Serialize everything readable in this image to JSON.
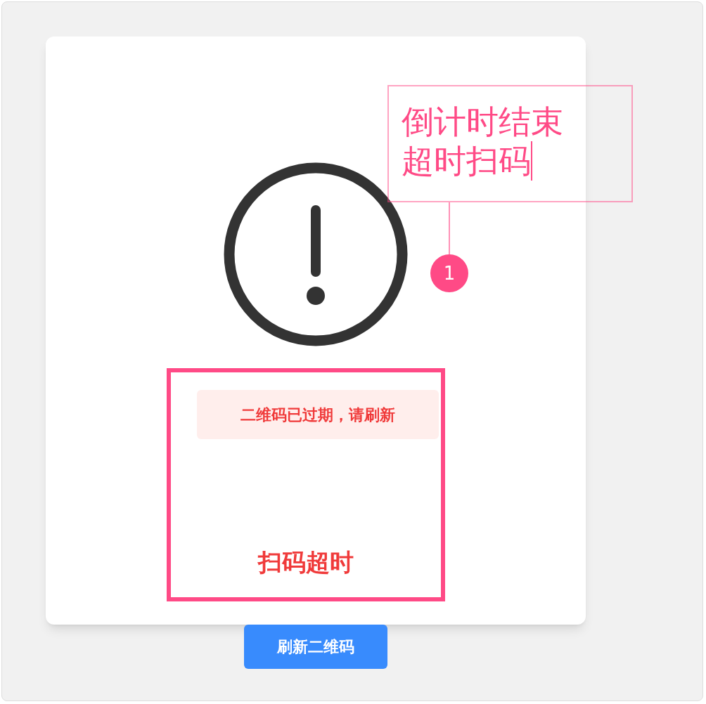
{
  "card": {
    "notice": "二维码已过期，请刷新",
    "status": "扫码超时"
  },
  "refresh_button": "刷新二维码",
  "annotation": {
    "lines": [
      "倒计时结束",
      "超时扫码"
    ],
    "badge": "1"
  }
}
